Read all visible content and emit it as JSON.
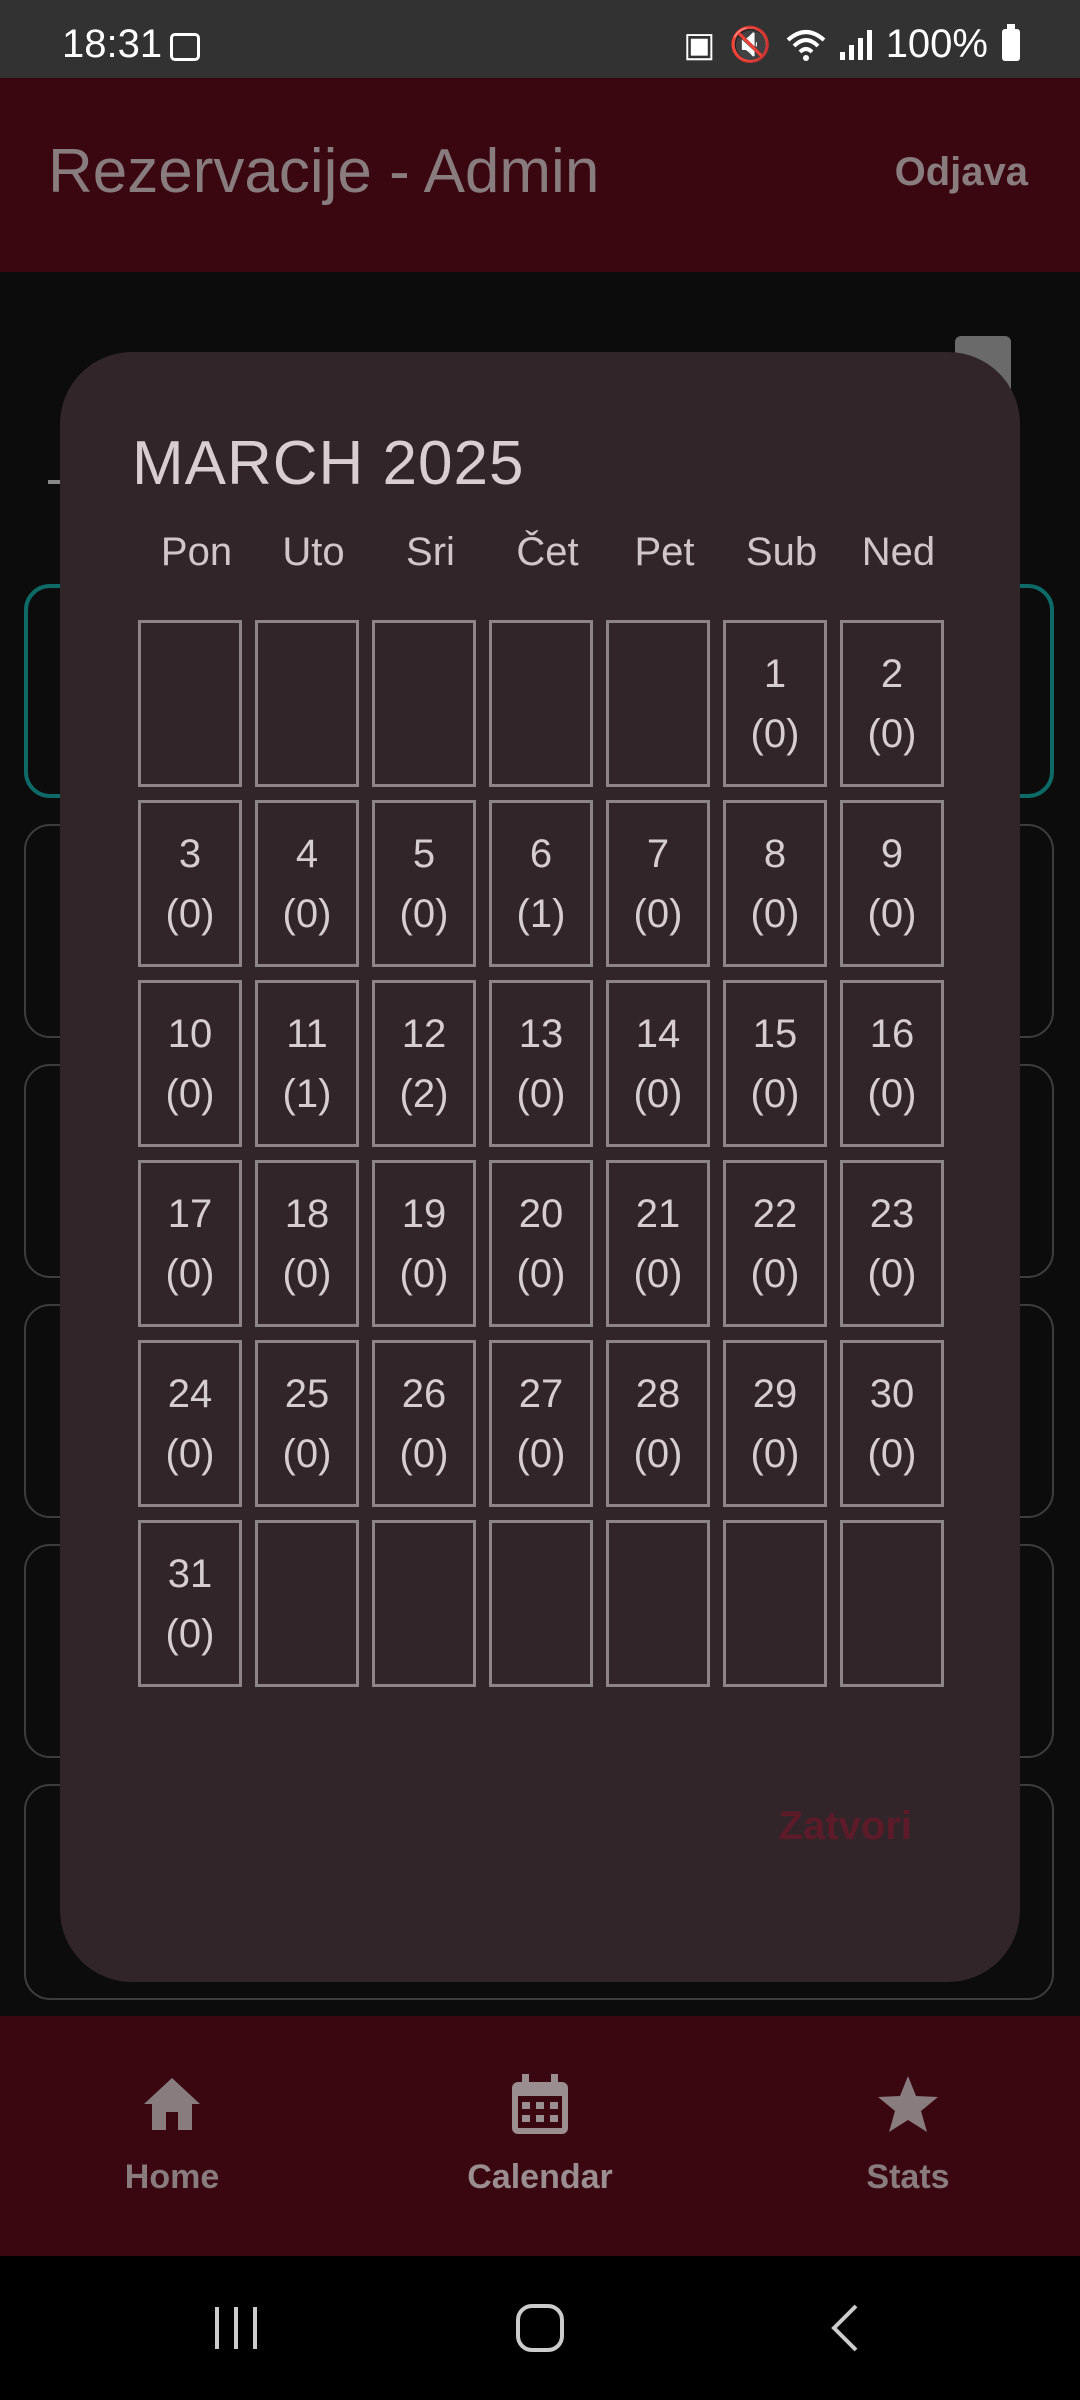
{
  "status_bar": {
    "time": "18:31",
    "battery": "100%",
    "icons": [
      "gallery-icon",
      "battery-saver-icon",
      "mute-icon",
      "wifi-icon",
      "signal-icon",
      "battery-icon"
    ]
  },
  "app_bar": {
    "title": "Rezervacije - Admin",
    "logout_label": "Odjava"
  },
  "dialog": {
    "title": "MARCH 2025",
    "weekdays": [
      "Pon",
      "Uto",
      "Sri",
      "Čet",
      "Pet",
      "Sub",
      "Ned"
    ],
    "weeks": [
      [
        null,
        null,
        null,
        null,
        null,
        {
          "day": "1",
          "count": "(0)"
        },
        {
          "day": "2",
          "count": "(0)"
        }
      ],
      [
        {
          "day": "3",
          "count": "(0)"
        },
        {
          "day": "4",
          "count": "(0)"
        },
        {
          "day": "5",
          "count": "(0)"
        },
        {
          "day": "6",
          "count": "(1)"
        },
        {
          "day": "7",
          "count": "(0)"
        },
        {
          "day": "8",
          "count": "(0)"
        },
        {
          "day": "9",
          "count": "(0)"
        }
      ],
      [
        {
          "day": "10",
          "count": "(0)"
        },
        {
          "day": "11",
          "count": "(1)"
        },
        {
          "day": "12",
          "count": "(2)"
        },
        {
          "day": "13",
          "count": "(0)"
        },
        {
          "day": "14",
          "count": "(0)"
        },
        {
          "day": "15",
          "count": "(0)"
        },
        {
          "day": "16",
          "count": "(0)"
        }
      ],
      [
        {
          "day": "17",
          "count": "(0)"
        },
        {
          "day": "18",
          "count": "(0)"
        },
        {
          "day": "19",
          "count": "(0)"
        },
        {
          "day": "20",
          "count": "(0)"
        },
        {
          "day": "21",
          "count": "(0)"
        },
        {
          "day": "22",
          "count": "(0)"
        },
        {
          "day": "23",
          "count": "(0)"
        }
      ],
      [
        {
          "day": "24",
          "count": "(0)"
        },
        {
          "day": "25",
          "count": "(0)"
        },
        {
          "day": "26",
          "count": "(0)"
        },
        {
          "day": "27",
          "count": "(0)"
        },
        {
          "day": "28",
          "count": "(0)"
        },
        {
          "day": "29",
          "count": "(0)"
        },
        {
          "day": "30",
          "count": "(0)"
        }
      ],
      [
        {
          "day": "31",
          "count": "(0)"
        },
        null,
        null,
        null,
        null,
        null,
        null
      ]
    ],
    "close_label": "Zatvori"
  },
  "bottom_nav": {
    "items": [
      {
        "label": "Home",
        "icon": "home-icon"
      },
      {
        "label": "Calendar",
        "icon": "calendar-icon",
        "selected": true
      },
      {
        "label": "Stats",
        "icon": "star-icon"
      }
    ]
  },
  "colors": {
    "app_bar": "#3a0711",
    "dialog_bg": "#322529",
    "accent_close": "#5d1a29",
    "active_card_border": "#0d6a66"
  }
}
